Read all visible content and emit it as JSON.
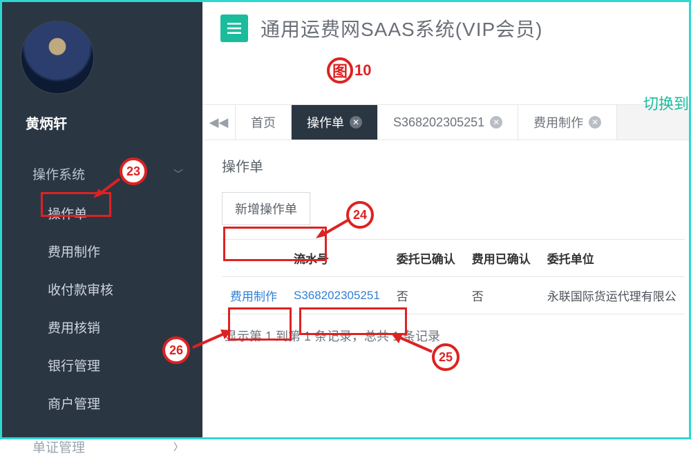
{
  "user": {
    "name": "黄炳轩"
  },
  "sidebar": {
    "sections": [
      {
        "header": "操作系统",
        "expanded": true,
        "items": [
          {
            "label": "操作单"
          },
          {
            "label": "费用制作"
          },
          {
            "label": "收付款审核"
          },
          {
            "label": "费用核销"
          },
          {
            "label": "银行管理"
          },
          {
            "label": "商户管理"
          }
        ]
      },
      {
        "header": "单证管理",
        "expanded": false,
        "items": []
      }
    ]
  },
  "header": {
    "title": "通用运费网SAAS系统(VIP会员)",
    "switch_label": "切换到"
  },
  "tabs": [
    {
      "label": "首页",
      "closable": false,
      "active": false
    },
    {
      "label": "操作单",
      "closable": true,
      "active": true
    },
    {
      "label": "S368202305251",
      "closable": true,
      "active": false
    },
    {
      "label": "费用制作",
      "closable": true,
      "active": false
    }
  ],
  "panel": {
    "title": "操作单",
    "add_button": "新增操作单",
    "columns": [
      "",
      "流水号",
      "委托已确认",
      "费用已确认",
      "委托单位"
    ],
    "rows": [
      {
        "action": "费用制作",
        "serial": "S368202305251",
        "commission_confirmed": "否",
        "fee_confirmed": "否",
        "client": "永联国际货运代理有限公"
      }
    ],
    "record_info": "显示第 1 到第 1 条记录，总共 1 条记录"
  },
  "annotations": {
    "figure": "图10",
    "n23": "23",
    "n24": "24",
    "n25": "25",
    "n26": "26",
    "figure_char": "图",
    "figure_num": "10"
  }
}
